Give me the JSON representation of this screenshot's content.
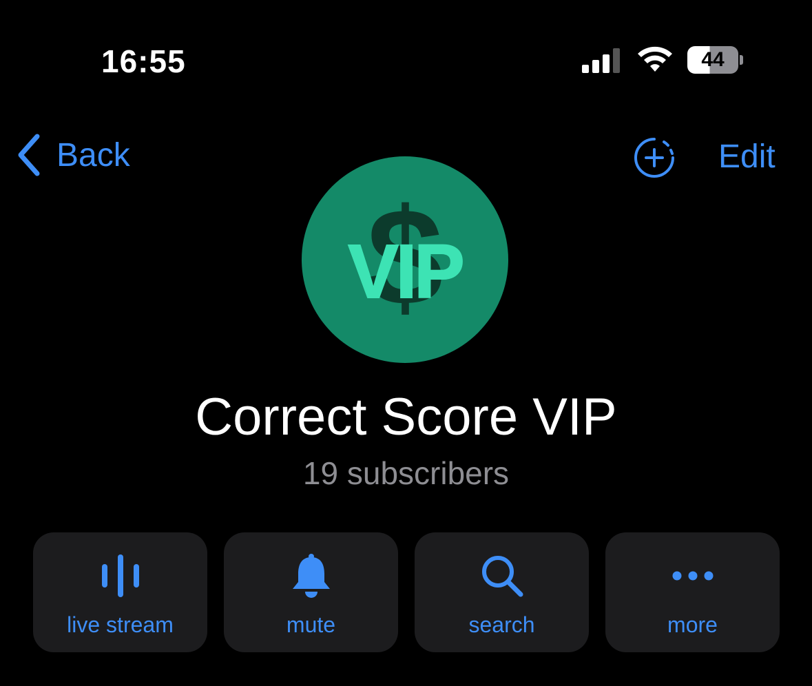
{
  "status_bar": {
    "time": "16:55",
    "battery": "44"
  },
  "nav": {
    "back_label": "Back",
    "edit_label": "Edit"
  },
  "channel": {
    "avatar_text": "VIP",
    "avatar_symbol": "$",
    "title": "Correct Score VIP",
    "subtitle": "19 subscribers"
  },
  "actions": [
    {
      "label": "live stream",
      "icon": "live-stream-icon"
    },
    {
      "label": "mute",
      "icon": "bell-icon"
    },
    {
      "label": "search",
      "icon": "search-icon"
    },
    {
      "label": "more",
      "icon": "more-icon"
    }
  ],
  "colors": {
    "accent": "#3e8ef7",
    "background": "#000000",
    "button_bg": "#1c1c1e",
    "secondary_text": "#8e8e93",
    "avatar_bg": "#148a68",
    "avatar_text": "#3de3b4"
  }
}
